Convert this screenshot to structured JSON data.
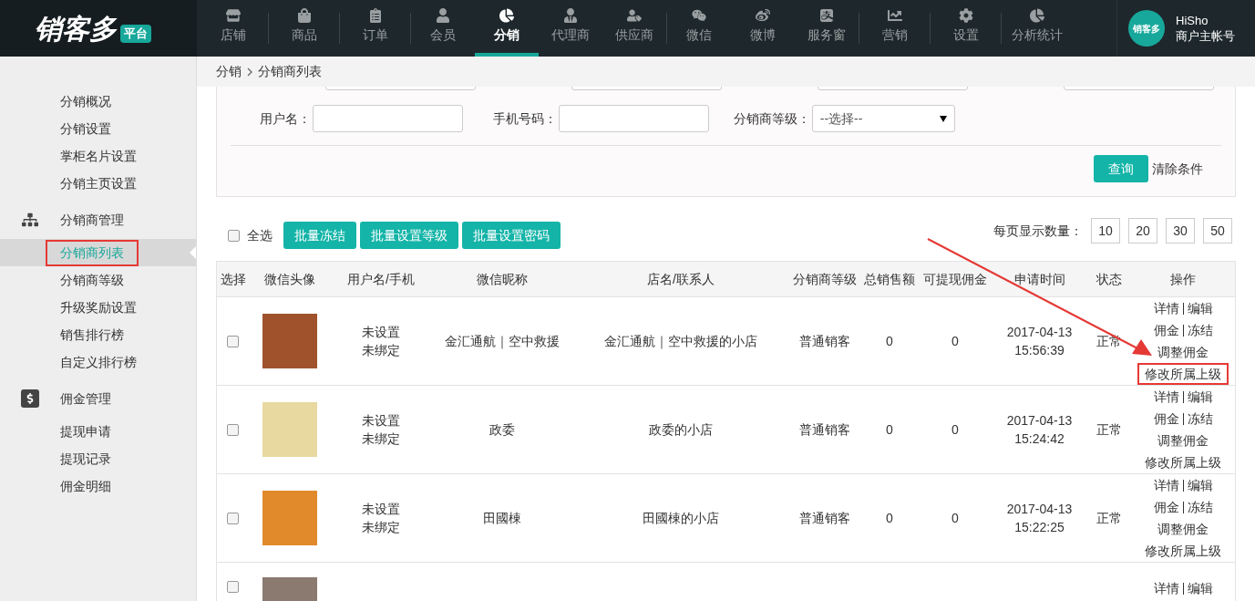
{
  "header": {
    "logo": "销客多",
    "logo_badge": "平台",
    "nav_groups": [
      [
        {
          "label": "店铺",
          "selected": false
        }
      ],
      [
        {
          "label": "商品",
          "selected": false
        }
      ],
      [
        {
          "label": "订单",
          "selected": false
        }
      ],
      [
        {
          "label": "会员",
          "selected": false
        },
        {
          "label": "分销",
          "selected": true
        },
        {
          "label": "代理商",
          "selected": false
        },
        {
          "label": "供应商",
          "selected": false
        }
      ],
      [
        {
          "label": "微信",
          "selected": false
        },
        {
          "label": "微博",
          "selected": false
        },
        {
          "label": "服务窗",
          "selected": false
        }
      ],
      [
        {
          "label": "营销",
          "selected": false
        }
      ],
      [
        {
          "label": "设置",
          "selected": false
        }
      ],
      [
        {
          "label": "分析统计",
          "selected": false
        }
      ]
    ],
    "user": {
      "avatar_text": "销客多",
      "name": "HiSho",
      "role": "商户主帐号"
    }
  },
  "sidebar": [
    {
      "items": [
        {
          "label": "分销概况",
          "selected": false,
          "boxed": false
        },
        {
          "label": "分销设置",
          "selected": false,
          "boxed": false
        },
        {
          "label": "掌柜名片设置",
          "selected": false,
          "boxed": false
        },
        {
          "label": "分销主页设置",
          "selected": false,
          "boxed": false
        }
      ]
    },
    {
      "title": "分销商管理",
      "kind": "network",
      "items": [
        {
          "label": "分销商列表",
          "selected": true,
          "boxed": true
        },
        {
          "label": "分销商等级",
          "selected": false,
          "boxed": false
        },
        {
          "label": "升级奖励设置",
          "selected": false,
          "boxed": false
        },
        {
          "label": "销售排行榜",
          "selected": false,
          "boxed": false
        },
        {
          "label": "自定义排行榜",
          "selected": false,
          "boxed": false
        }
      ]
    },
    {
      "title": "佣金管理",
      "kind": "money",
      "items": [
        {
          "label": "提现申请",
          "selected": false,
          "boxed": false
        },
        {
          "label": "提现记录",
          "selected": false,
          "boxed": false
        },
        {
          "label": "佣金明细",
          "selected": false,
          "boxed": false
        }
      ]
    }
  ],
  "breadcrumb": [
    "分销",
    "分销商列表"
  ],
  "filters": {
    "fields": [
      {
        "label": "用户名："
      },
      {
        "label": "手机号码："
      },
      {
        "label": "分销商等级：",
        "kind": "select",
        "value": "--选择--"
      }
    ],
    "query_button": "查询",
    "clear_link": "清除条件"
  },
  "toolbar": {
    "select_all": {
      "label": "全选",
      "checked": false
    },
    "buttons": [
      "批量冻结",
      "批量设置等级",
      "批量设置密码"
    ],
    "page_size_label": "每页显示数量：",
    "page_sizes": [
      "10",
      "20",
      "30",
      "50"
    ]
  },
  "table": {
    "columns": [
      "选择",
      "微信头像",
      "用户名/手机",
      "微信昵称",
      "店名/联系人",
      "分销商等级",
      "总销售额",
      "可提现佣金",
      "申请时间",
      "状态",
      "操作"
    ],
    "rows": [
      {
        "checked": false,
        "username": [
          "未设置",
          "未绑定"
        ],
        "nickname": "金汇通航｜空中救援",
        "shop": "金汇通航｜空中救援的小店",
        "level": "普通销客",
        "sales": "0",
        "commission": "0",
        "date": "2017-04-13",
        "time": "15:56:39",
        "status": "正常",
        "actions": [
          {
            "links": [
              "详情",
              "编辑"
            ],
            "boxed": false
          },
          {
            "links": [
              "佣金",
              "冻结"
            ],
            "boxed": false
          },
          {
            "links": [
              "调整佣金"
            ],
            "boxed": false
          },
          {
            "links": [
              "修改所属上级"
            ],
            "boxed": true
          }
        ]
      },
      {
        "checked": false,
        "username": [
          "未设置",
          "未绑定"
        ],
        "nickname": "政委",
        "shop": "政委的小店",
        "level": "普通销客",
        "sales": "0",
        "commission": "0",
        "date": "2017-04-13",
        "time": "15:24:42",
        "status": "正常",
        "actions": [
          {
            "links": [
              "详情",
              "编辑"
            ],
            "boxed": false
          },
          {
            "links": [
              "佣金",
              "冻结"
            ],
            "boxed": false
          },
          {
            "links": [
              "调整佣金"
            ],
            "boxed": false
          },
          {
            "links": [
              "修改所属上级"
            ],
            "boxed": false
          }
        ]
      },
      {
        "checked": false,
        "username": [
          "未设置",
          "未绑定"
        ],
        "nickname": "田國棟",
        "shop": "田國棟的小店",
        "level": "普通销客",
        "sales": "0",
        "commission": "0",
        "date": "2017-04-13",
        "time": "15:22:25",
        "status": "正常",
        "actions": [
          {
            "links": [
              "详情",
              "编辑"
            ],
            "boxed": false
          },
          {
            "links": [
              "佣金",
              "冻结"
            ],
            "boxed": false
          },
          {
            "links": [
              "调整佣金"
            ],
            "boxed": false
          },
          {
            "links": [
              "修改所属上级"
            ],
            "boxed": false
          }
        ]
      },
      {
        "checked": false,
        "actions": [
          {
            "links": [
              "详情",
              "编辑"
            ],
            "boxed": false
          }
        ]
      }
    ]
  }
}
